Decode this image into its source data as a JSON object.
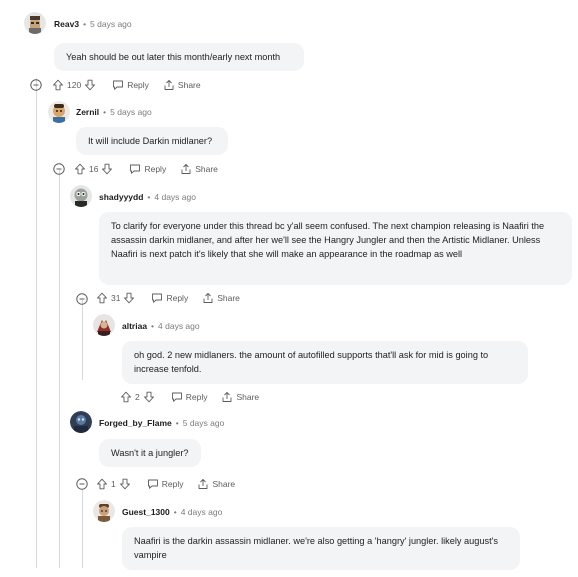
{
  "comments": [
    {
      "user": "Reav3",
      "time": "5 days ago",
      "text": "Yeah should be out later this month/early next month",
      "upvotes": "120",
      "reply_label": "Reply",
      "share_label": "Share"
    },
    {
      "user": "Zernil",
      "time": "5 days ago",
      "text": "It will include Darkin midlaner?",
      "upvotes": "16",
      "reply_label": "Reply",
      "share_label": "Share"
    },
    {
      "user": "shadyyydd",
      "time": "4 days ago",
      "text": "To clarify for everyone under this thread bc y'all seem confused. The next champion releasing is Naafiri the assassin darkin midlaner, and after her we'll see the Hangry Jungler and then the Artistic Midlaner. Unless Naafiri is next patch it's likely that she will make an appearance in the roadmap as well",
      "upvotes": "31",
      "reply_label": "Reply",
      "share_label": "Share"
    },
    {
      "user": "altriaa",
      "time": "4 days ago",
      "text": "oh god. 2 new midlaners. the amount of autofilled supports that'll ask for mid is going to increase tenfold.",
      "upvotes": "2",
      "reply_label": "Reply",
      "share_label": "Share"
    },
    {
      "user": "Forged_by_Flame",
      "time": "5 days ago",
      "text": "Wasn't it a jungler?",
      "upvotes": "1",
      "reply_label": "Reply",
      "share_label": "Share"
    },
    {
      "user": "Guest_1300",
      "time": "4 days ago",
      "text": "Naafiri is the darkin assassin midlaner. we're also getting a 'hangry' jungler. likely august's vampire"
    }
  ],
  "separator": "•",
  "colors": {
    "bubble": "#f2f4f5",
    "meta": "#7c7c7c",
    "action": "#5c5c5c",
    "thread_line": "#d6d9db"
  },
  "icons": [
    "upvote-icon",
    "downvote-icon",
    "reply-icon",
    "share-icon",
    "collapse-icon"
  ]
}
